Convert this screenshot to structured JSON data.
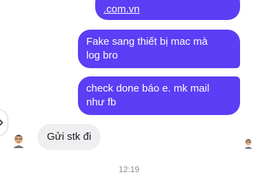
{
  "messages": [
    {
      "id": "m0",
      "direction": "outgoing",
      "text": ".com.vn"
    },
    {
      "id": "m1",
      "direction": "outgoing",
      "text": "Fake sang thiết bị mac mà\nlog bro"
    },
    {
      "id": "m2",
      "direction": "outgoing",
      "text": "check done báo e. mk mail\nnhư fb"
    },
    {
      "id": "m3",
      "direction": "incoming",
      "text": "Gửi stk đi"
    }
  ],
  "timestamp": "12:19",
  "colors": {
    "outgoing_bubble": "#5b3ef5",
    "incoming_bubble": "#efeff1",
    "timestamp_text": "#8e8e93"
  },
  "icons": {
    "expand": "chevron-right-icon",
    "sender_avatar": "memoji-avatar-icon",
    "seen_receipt": "memoji-avatar-icon"
  }
}
